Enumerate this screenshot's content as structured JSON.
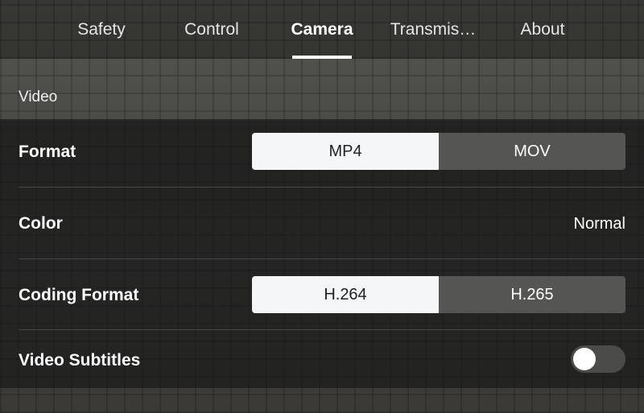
{
  "tabs": [
    {
      "label": "Safety",
      "active": false
    },
    {
      "label": "Control",
      "active": false
    },
    {
      "label": "Camera",
      "active": true
    },
    {
      "label": "Transmis…",
      "active": false
    },
    {
      "label": "About",
      "active": false
    }
  ],
  "section": {
    "title": "Video"
  },
  "settings": {
    "format": {
      "label": "Format",
      "options": [
        "MP4",
        "MOV"
      ],
      "selected": "MP4"
    },
    "color": {
      "label": "Color",
      "value": "Normal"
    },
    "coding_format": {
      "label": "Coding Format",
      "options": [
        "H.264",
        "H.265"
      ],
      "selected": "H.264"
    },
    "video_subtitles": {
      "label": "Video Subtitles",
      "enabled": false
    }
  },
  "colors": {
    "selected_segment": "#f4f6f8",
    "unselected_segment": "#555553",
    "panel": "#1c1c1c"
  }
}
